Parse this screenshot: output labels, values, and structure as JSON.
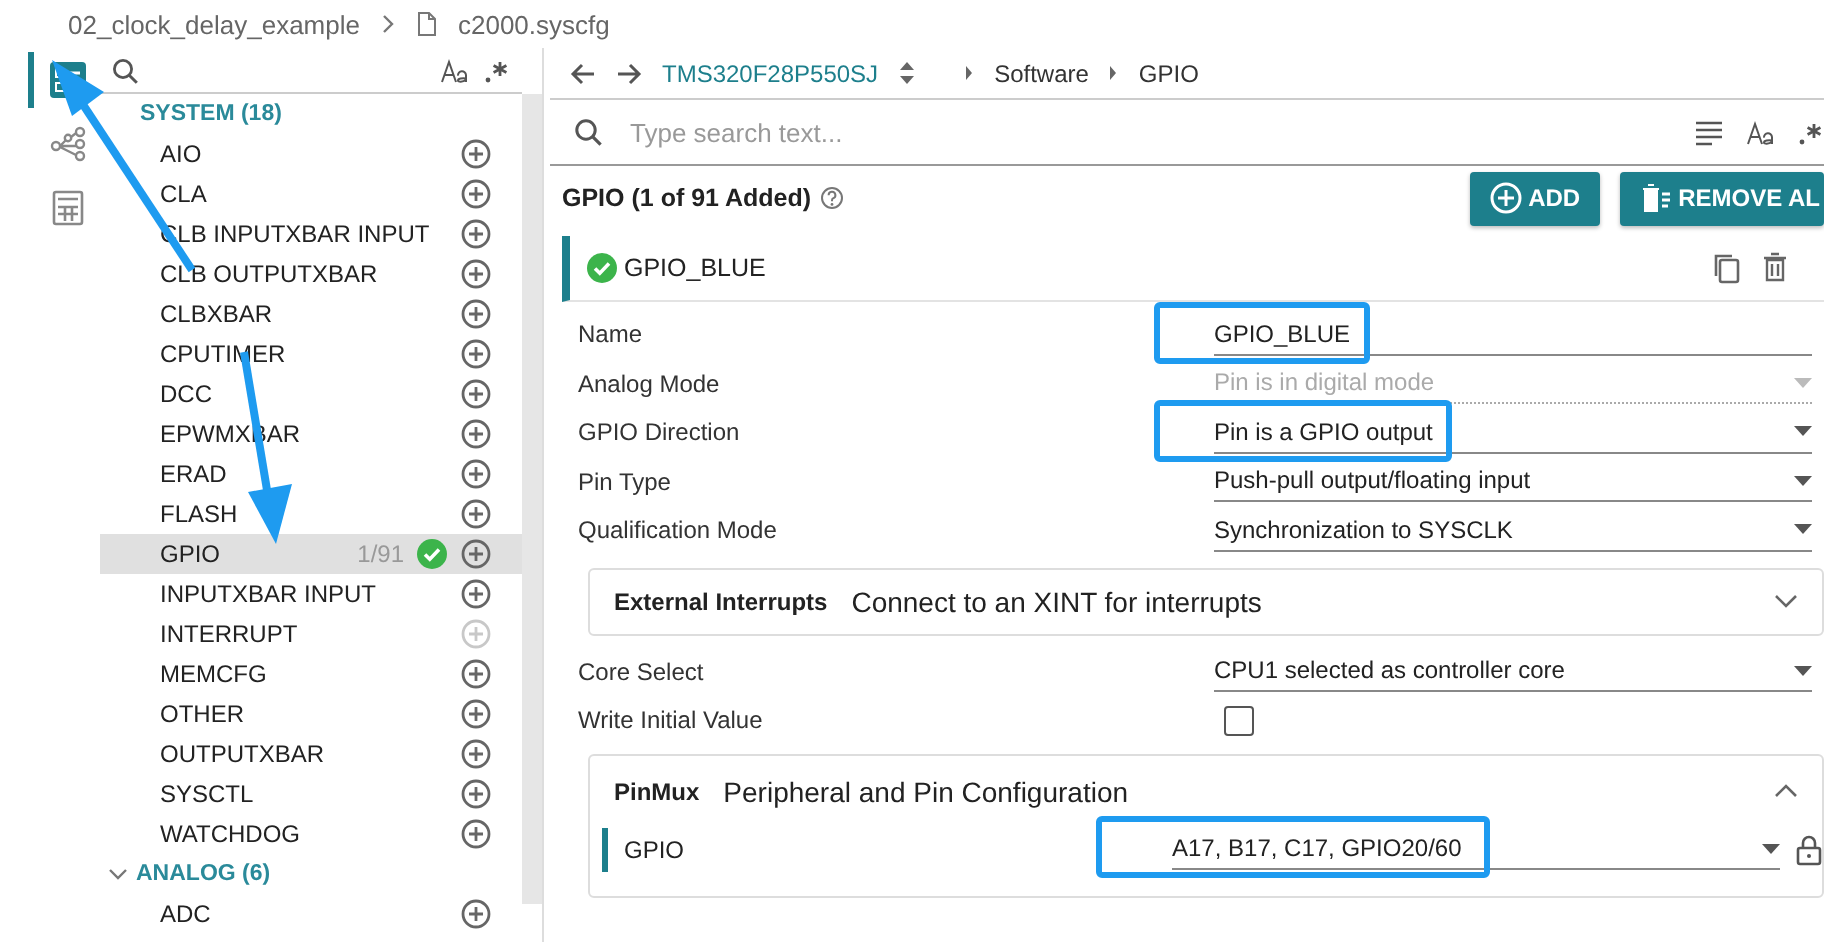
{
  "breadcrumb": {
    "project": "02_clock_delay_example",
    "file": "c2000.syscfg"
  },
  "activity_bar": [
    {
      "kind": "list",
      "selected": true
    },
    {
      "kind": "tree",
      "selected": false
    },
    {
      "kind": "calculator",
      "selected": false
    }
  ],
  "sidebar": {
    "groups": [
      {
        "title": "SYSTEM (18)",
        "kind": "plain",
        "items": [
          {
            "label": "AIO",
            "selected": false,
            "disabled": false
          },
          {
            "label": "CLA",
            "selected": false,
            "disabled": false
          },
          {
            "label": "CLB INPUTXBAR INPUT",
            "selected": false,
            "disabled": false
          },
          {
            "label": "CLB OUTPUTXBAR",
            "selected": false,
            "disabled": false
          },
          {
            "label": "CLBXBAR",
            "selected": false,
            "disabled": false
          },
          {
            "label": "CPUTIMER",
            "selected": false,
            "disabled": false
          },
          {
            "label": "DCC",
            "selected": false,
            "disabled": false
          },
          {
            "label": "EPWMXBAR",
            "selected": false,
            "disabled": false
          },
          {
            "label": "ERAD",
            "selected": false,
            "disabled": false
          },
          {
            "label": "FLASH",
            "selected": false,
            "disabled": false
          },
          {
            "label": "GPIO",
            "selected": true,
            "disabled": false,
            "count": "1/91",
            "added": true
          },
          {
            "label": "INPUTXBAR INPUT",
            "selected": false,
            "disabled": false
          },
          {
            "label": "INTERRUPT",
            "selected": false,
            "disabled": true
          },
          {
            "label": "MEMCFG",
            "selected": false,
            "disabled": false
          },
          {
            "label": "OTHER",
            "selected": false,
            "disabled": false
          },
          {
            "label": "OUTPUTXBAR",
            "selected": false,
            "disabled": false
          },
          {
            "label": "SYSCTL",
            "selected": false,
            "disabled": false
          },
          {
            "label": "WATCHDOG",
            "selected": false,
            "disabled": false
          }
        ]
      },
      {
        "title": "ANALOG (6)",
        "kind": "collapsible",
        "items": [
          {
            "label": "ADC",
            "selected": false,
            "disabled": false
          }
        ]
      }
    ]
  },
  "nav": {
    "device": "TMS320F28P550SJ",
    "path": [
      "Software",
      "GPIO"
    ]
  },
  "search": {
    "placeholder": "Type search text..."
  },
  "header": {
    "title": "GPIO (1 of 91 Added)",
    "buttons": [
      {
        "label": "ADD",
        "kind": "add"
      },
      {
        "label": "REMOVE AL",
        "kind": "remove"
      }
    ]
  },
  "instance": {
    "name": "GPIO_BLUE"
  },
  "fields": [
    {
      "label": "Name",
      "kind": "text",
      "value": "GPIO_BLUE",
      "disabled": false,
      "highlighted": true
    },
    {
      "label": "Analog Mode",
      "kind": "select",
      "value": "Pin is in digital mode",
      "disabled": true,
      "highlighted": false
    },
    {
      "label": "GPIO Direction",
      "kind": "select",
      "value": "Pin is a GPIO output",
      "disabled": false,
      "highlighted": true
    },
    {
      "label": "Pin Type",
      "kind": "select",
      "value": "Push-pull output/floating input",
      "disabled": false,
      "highlighted": false
    },
    {
      "label": "Qualification Mode",
      "kind": "select",
      "value": "Synchronization to SYSCLK",
      "disabled": false,
      "highlighted": false
    }
  ],
  "external_interrupts": {
    "title": "External Interrupts",
    "description": "Connect to an XINT for interrupts",
    "expanded": false
  },
  "more_fields": [
    {
      "label": "Core Select",
      "kind": "select",
      "value": "CPU1 selected as controller core",
      "disabled": false,
      "highlighted": false
    },
    {
      "label": "Write Initial Value",
      "kind": "checkbox",
      "checked": false,
      "disabled": false,
      "highlighted": false
    }
  ],
  "pinmux": {
    "title": "PinMux",
    "description": "Peripheral and Pin Configuration",
    "expanded": true,
    "rows": [
      {
        "label": "GPIO",
        "value": "A17, B17, C17, GPIO20/60",
        "highlighted": true
      }
    ]
  }
}
